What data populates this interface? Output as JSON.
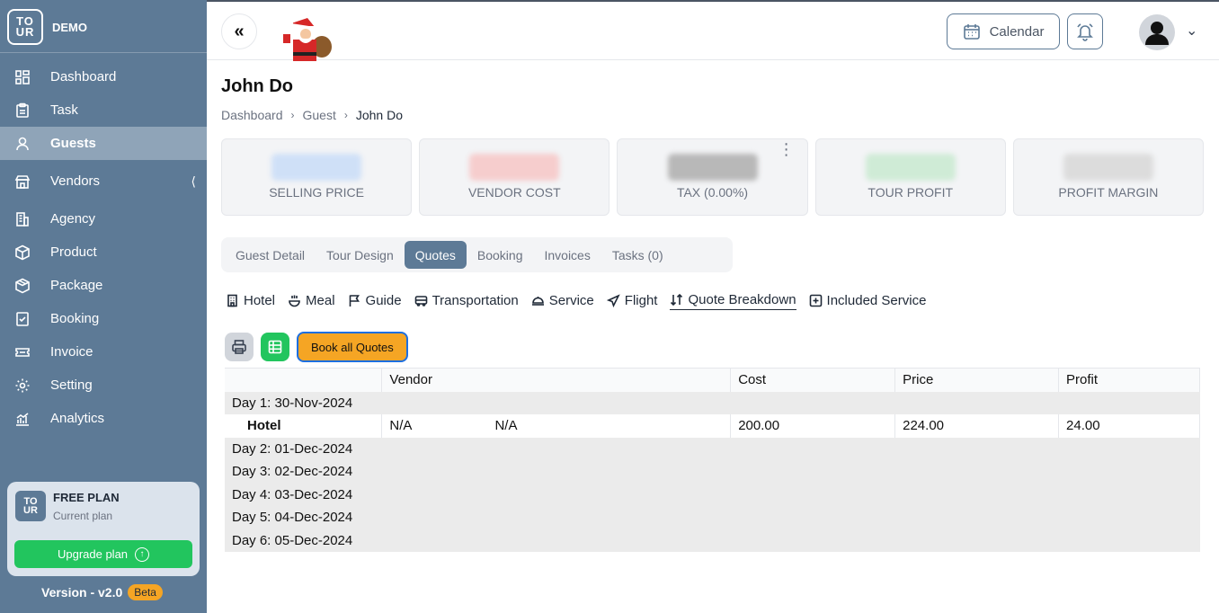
{
  "brand": {
    "name": "DEMO",
    "logo_top": "TO",
    "logo_bottom": "UR"
  },
  "sidebar": {
    "items": [
      {
        "label": "Dashboard",
        "icon": "dashboard-icon"
      },
      {
        "label": "Task",
        "icon": "clipboard-icon"
      },
      {
        "label": "Guests",
        "icon": "user-icon",
        "active": true
      },
      {
        "label": "Vendors",
        "icon": "store-icon"
      },
      {
        "label": "Agency",
        "icon": "building-icon"
      },
      {
        "label": "Product",
        "icon": "box-icon"
      },
      {
        "label": "Package",
        "icon": "package-icon"
      },
      {
        "label": "Booking",
        "icon": "booking-icon"
      },
      {
        "label": "Invoice",
        "icon": "ticket-icon"
      },
      {
        "label": "Setting",
        "icon": "gear-icon"
      },
      {
        "label": "Analytics",
        "icon": "analytics-icon"
      }
    ],
    "plan": {
      "title": "FREE PLAN",
      "subtitle": "Current plan",
      "upgrade_label": "Upgrade plan"
    },
    "version": {
      "label": "Version - v2.0",
      "badge": "Beta"
    }
  },
  "header": {
    "calendar_label": "Calendar"
  },
  "page": {
    "title": "John Do",
    "breadcrumb": [
      "Dashboard",
      "Guest",
      "John Do"
    ]
  },
  "stats": [
    {
      "label": "SELLING PRICE",
      "color": "#cfe0f7"
    },
    {
      "label": "VENDOR COST",
      "color": "#f6cdcd"
    },
    {
      "label": "TAX (0.00%)",
      "color": "#b8b8b8"
    },
    {
      "label": "TOUR PROFIT",
      "color": "#cfebd6"
    },
    {
      "label": "PROFIT MARGIN",
      "color": "#dcdcdc"
    }
  ],
  "tabs": [
    "Guest Detail",
    "Tour Design",
    "Quotes",
    "Booking",
    "Invoices",
    "Tasks (0)"
  ],
  "active_tab": "Quotes",
  "subtabs": [
    {
      "label": "Hotel",
      "icon": "hotel-icon"
    },
    {
      "label": "Meal",
      "icon": "meal-icon"
    },
    {
      "label": "Guide",
      "icon": "flag-icon"
    },
    {
      "label": "Transportation",
      "icon": "bus-icon"
    },
    {
      "label": "Service",
      "icon": "service-icon"
    },
    {
      "label": "Flight",
      "icon": "plane-icon"
    },
    {
      "label": "Quote Breakdown",
      "icon": "sort-icon",
      "active": true
    },
    {
      "label": "Included Service",
      "icon": "plus-square-icon"
    }
  ],
  "actions": {
    "book_label": "Book all Quotes"
  },
  "table": {
    "headers": [
      "",
      "Vendor",
      "Cost",
      "Price",
      "Profit"
    ],
    "days": [
      {
        "label": "Day 1: 30-Nov-2024",
        "items": [
          {
            "name": "Hotel",
            "vendor": "N/A",
            "vendor2": "N/A",
            "cost": "200.00",
            "price": "224.00",
            "profit": "24.00"
          }
        ]
      },
      {
        "label": "Day 2: 01-Dec-2024",
        "items": []
      },
      {
        "label": "Day 3: 02-Dec-2024",
        "items": []
      },
      {
        "label": "Day 4: 03-Dec-2024",
        "items": []
      },
      {
        "label": "Day 5: 04-Dec-2024",
        "items": []
      },
      {
        "label": "Day 6: 05-Dec-2024",
        "items": []
      }
    ]
  }
}
